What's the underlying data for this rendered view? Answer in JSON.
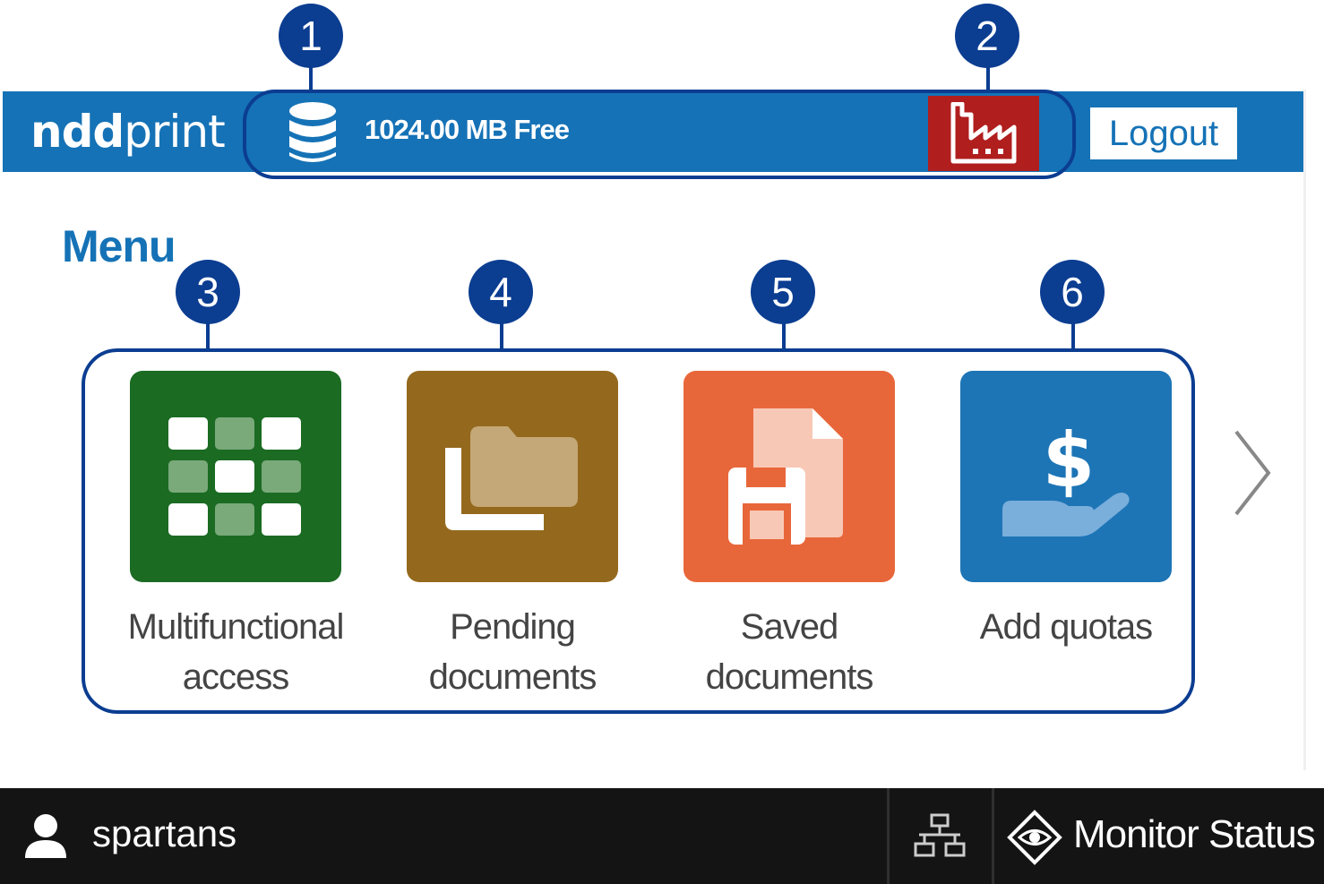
{
  "callouts": [
    "1",
    "2",
    "3",
    "4",
    "5",
    "6"
  ],
  "header": {
    "logo_bold": "ndd",
    "logo_light": "print",
    "storage_icon": "database-icon",
    "storage_text": "1024.00 MB Free",
    "factory_icon": "factory-icon",
    "logout_label": "Logout"
  },
  "menu": {
    "title": "Menu",
    "tiles": [
      {
        "line1": "Multifunctional",
        "line2": "access",
        "icon": "grid-icon",
        "color": "#1b6b23"
      },
      {
        "line1": "Pending",
        "line2": "documents",
        "icon": "folders-icon",
        "color": "#94691e"
      },
      {
        "line1": "Saved",
        "line2": "documents",
        "icon": "save-document-icon",
        "color": "#e8673a"
      },
      {
        "line1": "Add quotas",
        "line2": "",
        "icon": "money-hand-icon",
        "color": "#1d75b6"
      }
    ],
    "next_icon": "chevron-right-icon"
  },
  "statusbar": {
    "user_icon": "user-icon",
    "username": "spartans",
    "network_icon": "network-icon",
    "monitor_icon": "eye-diamond-icon",
    "monitor_label": "Monitor Status"
  },
  "colors": {
    "header_blue": "#1572b6",
    "callout_navy": "#0b3d91",
    "factory_red": "#b01e1e",
    "statusbar": "#141414"
  }
}
